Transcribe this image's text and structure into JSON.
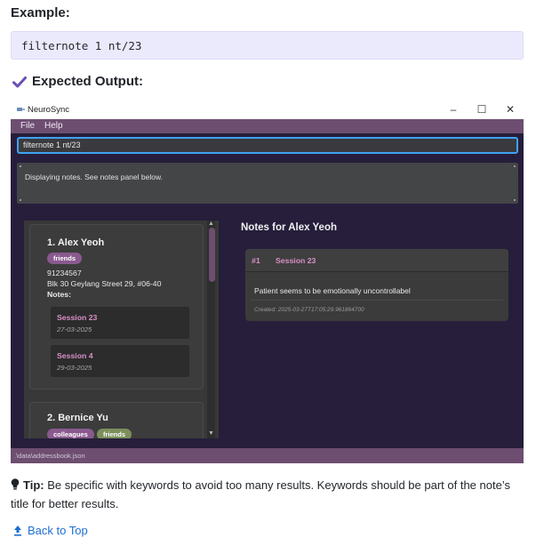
{
  "doc": {
    "example_heading": "Example:",
    "command": "filternote 1 nt/23",
    "expected_heading": "Expected Output:",
    "tip_label": "Tip:",
    "tip_text": "Be specific with keywords to avoid too many results. Keywords should be part of the note’s title for better results.",
    "back_to_top": "Back to Top"
  },
  "app": {
    "window_title": "NeuroSync",
    "window_controls": [
      "–",
      "☐",
      "✕"
    ],
    "menu": [
      "File",
      "Help"
    ],
    "command_value": "filternote 1 nt/23",
    "result_text": "Displaying notes. See notes panel below.",
    "persons": [
      {
        "name": "1.  Alex Yeoh",
        "tags": [
          {
            "label": "friends",
            "color": "#8a5a8e"
          }
        ],
        "phone": "91234567",
        "address": "Blk 30 Geylang Street 29, #06-40",
        "notes_label": "Notes:",
        "sessions": [
          {
            "title": "Session 23",
            "date": "27-03-2025"
          },
          {
            "title": "Session 4",
            "date": "29-03-2025"
          }
        ]
      },
      {
        "name": "2.  Bernice Yu",
        "tags": [
          {
            "label": "colleagues",
            "color": "#8a5a8e"
          },
          {
            "label": "friends",
            "color": "#7c8f5c"
          }
        ]
      }
    ],
    "notes_panel": {
      "title": "Notes for Alex Yeoh",
      "note": {
        "number": "#1",
        "title": "Session 23",
        "content": "Patient seems to be emotionally uncontrollabel",
        "created": "Created: 2025-03-27T17:05:29.961864700"
      }
    },
    "status_path": ".\\data\\addressbook.json"
  },
  "colors": {
    "accent": "#6d4e71",
    "app_bg": "#261e3b",
    "highlight_text": "#d88fc6",
    "focus_border": "#3fa2f2",
    "link": "#1d6fd0"
  },
  "icons": [
    "checkmark-icon",
    "app-icon",
    "lightbulb-icon",
    "arrow-up-icon"
  ]
}
